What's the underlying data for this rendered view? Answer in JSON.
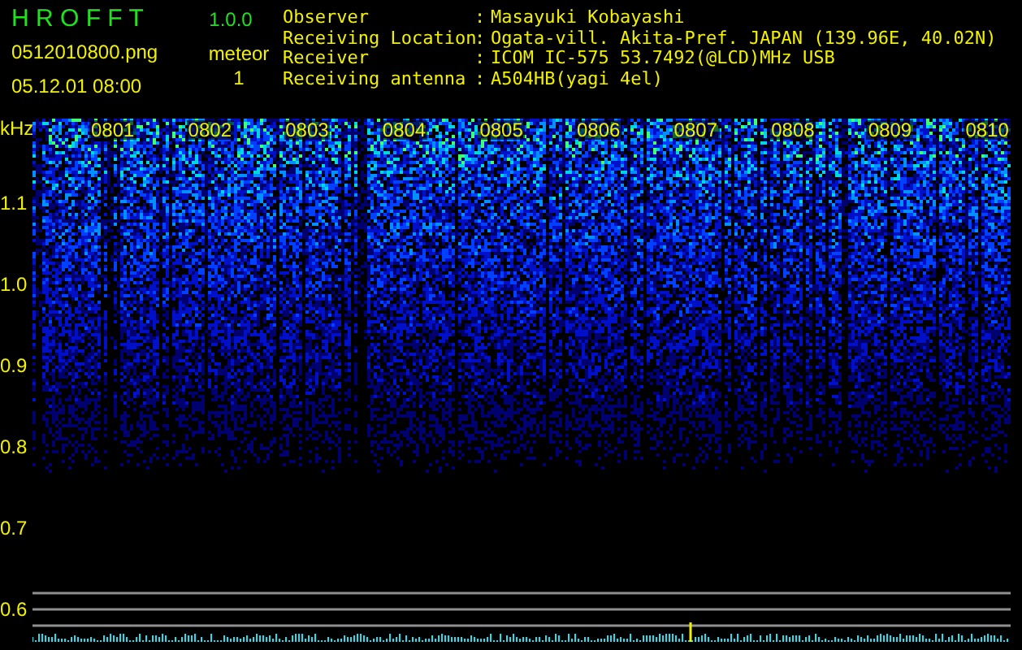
{
  "header": {
    "title": "H R O F F T",
    "version": "1.0.0",
    "filename": "0512010800.png",
    "datetime": "05.12.01 08:00",
    "count_label": "meteor",
    "count": "1"
  },
  "info": [
    {
      "label": "Observer",
      "separator": ":",
      "value": "Masayuki Kobayashi"
    },
    {
      "label": "Receiving Location",
      "separator": ":",
      "value": "Ogata-vill. Akita-Pref. JAPAN (139.96E, 40.02N)"
    },
    {
      "label": "Receiver",
      "separator": ":",
      "value": "ICOM IC-575 53.7492(@LCD)MHz USB"
    },
    {
      "label": "Receiving antenna",
      "separator": ":",
      "value": "A504HB(yagi 4el)"
    }
  ],
  "spectrogram": {
    "unit": "kHz",
    "y_labels": [
      "1.1",
      "1.0",
      "0.9",
      "0.8",
      "0.7",
      "0.6"
    ],
    "time_labels": [
      "0801",
      "0802",
      "0803",
      "0804",
      "0805",
      "0806",
      "0807",
      "0808",
      "0809",
      "0810"
    ]
  }
}
